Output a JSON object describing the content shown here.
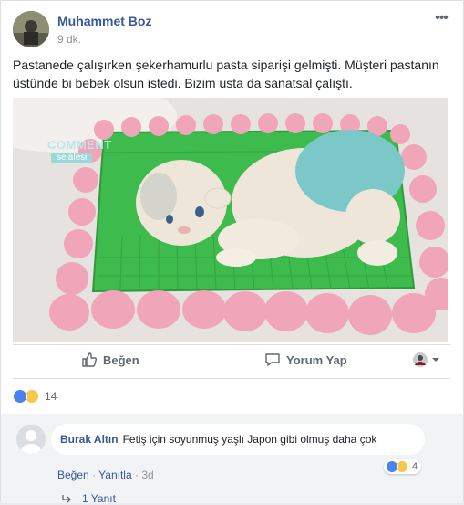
{
  "post": {
    "author": "Muhammet Boz",
    "time": "9 dk.",
    "more_label": "•••",
    "text": "Pastanede çalışırken şekerhamurlu pasta siparişi gelmişti. Müşteri pastanın üstünde bi bebek olsun istedi. Bizim usta da sanatsal çalıştı."
  },
  "photo": {
    "watermark_line1": "COMMENT",
    "watermark_line2": "selalesi"
  },
  "actions": {
    "like_label": "Beğen",
    "comment_label": "Yorum Yap"
  },
  "reactions": {
    "count": "14"
  },
  "comment": {
    "author": "Burak Altın",
    "text": "Fetiş için soyunmuş yaşlı Japon gibi olmuş daha çok",
    "reaction_count": "4",
    "like_link": "Beğen",
    "reply_link": "Yanıtla",
    "time": "3d",
    "separator": "·",
    "replies": "1 Yanıt"
  },
  "colors": {
    "link_blue": "#385898",
    "like_blue": "#4a81f5",
    "haha_yellow": "#f7c84a",
    "cake_green": "#3dbb4c",
    "fondant_pink": "#f0a5b8",
    "diaper_teal": "#7cc8c8"
  },
  "icons": {
    "like": "thumbs-up-icon",
    "comment": "speech-bubble-icon",
    "share": "avatar-dropdown-icon",
    "more": "ellipsis-icon",
    "reply": "reply-arrow-icon"
  }
}
